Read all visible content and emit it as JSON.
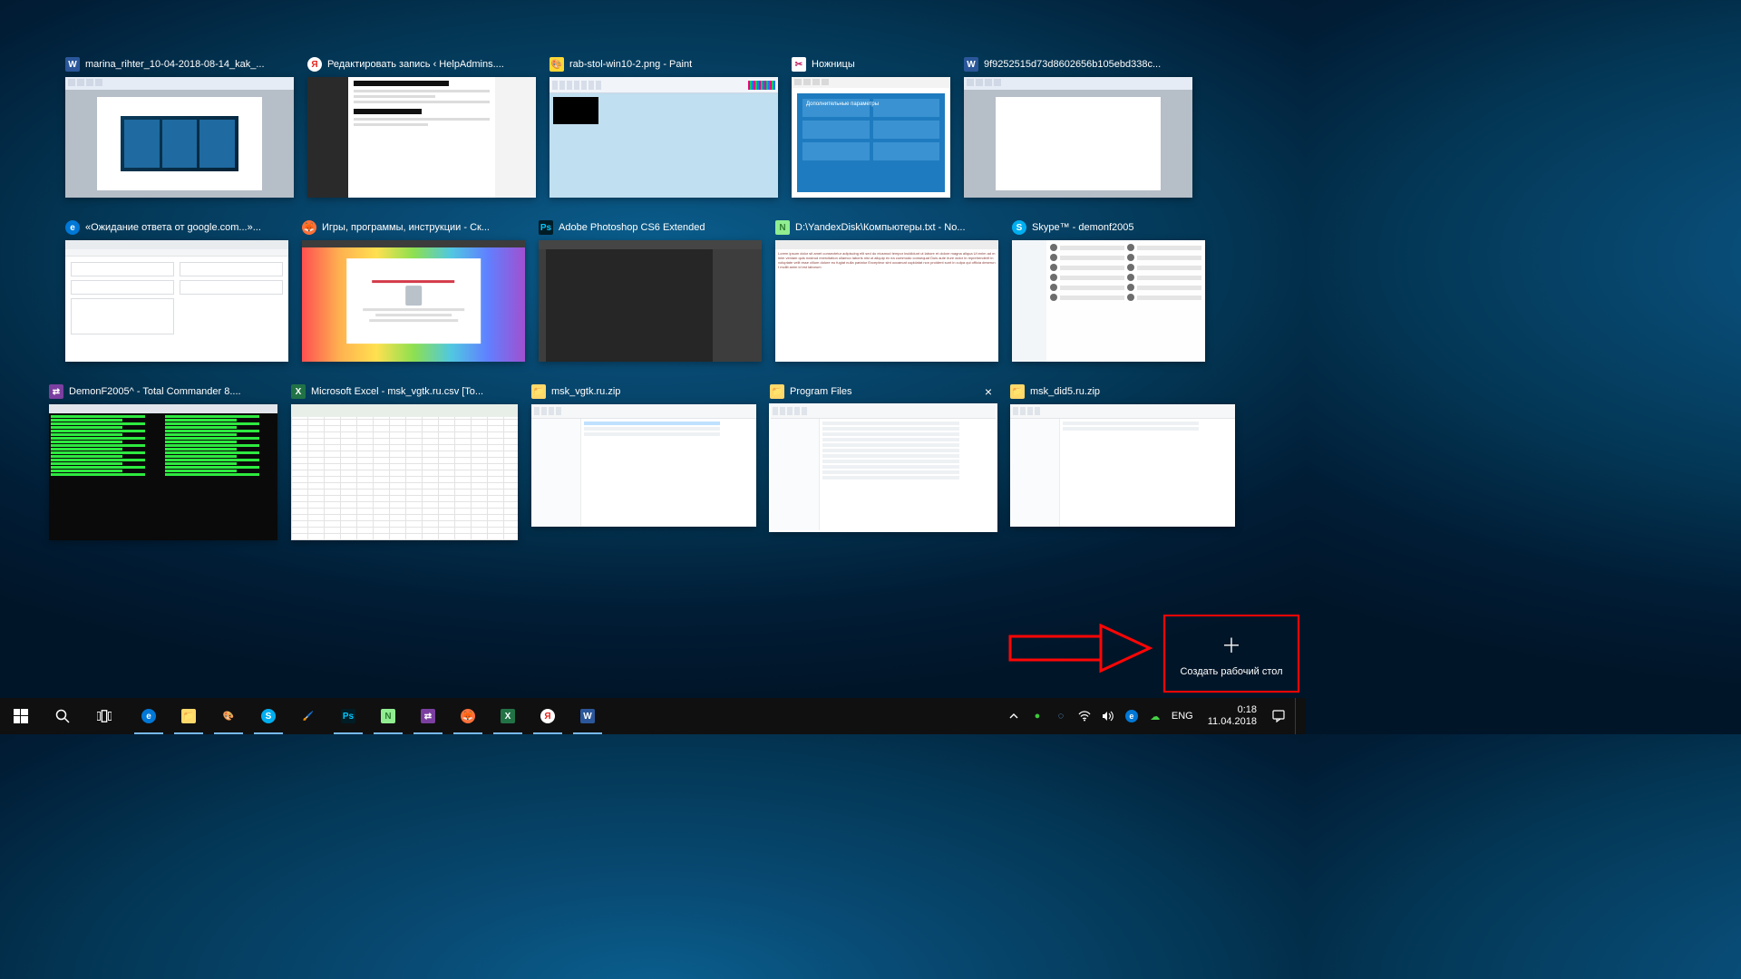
{
  "rows": [
    [
      {
        "id": "word1",
        "icon": "word",
        "title": "marina_rihter_10-04-2018-08-14_kak_..."
      },
      {
        "id": "yandex",
        "icon": "yandex",
        "title": "Редактировать запись ‹ HelpAdmins...."
      },
      {
        "id": "paint",
        "icon": "paint",
        "title": "rab-stol-win10-2.png - Paint"
      },
      {
        "id": "snip",
        "icon": "snip",
        "title": "Ножницы",
        "snip_caption": "Дополнительные параметры"
      },
      {
        "id": "word2",
        "icon": "word",
        "title": "9f9252515d73d8602656b105ebd338c..."
      }
    ],
    [
      {
        "id": "edge",
        "icon": "edge",
        "title": "«Ожидание ответа от google.com...»..."
      },
      {
        "id": "firefox",
        "icon": "firefox",
        "title": "Игры, программы, инструкции - Ск..."
      },
      {
        "id": "ps",
        "icon": "ps",
        "title": "Adobe Photoshop CS6 Extended"
      },
      {
        "id": "npp",
        "icon": "npp",
        "title": "D:\\YandexDisk\\Компьютеры.txt - No..."
      },
      {
        "id": "skype",
        "icon": "skype",
        "title": "Skype™ - demonf2005"
      }
    ],
    [
      {
        "id": "tc",
        "icon": "tc",
        "title": "DemonF2005^ - Total Commander 8...."
      },
      {
        "id": "excel",
        "icon": "excel",
        "title": "Microsoft Excel - msk_vgtk.ru.csv  [To..."
      },
      {
        "id": "zip1",
        "icon": "folder",
        "title": "msk_vgtk.ru.zip"
      },
      {
        "id": "pf",
        "icon": "folder",
        "title": "Program Files",
        "selected": true,
        "show_close": true
      },
      {
        "id": "zip2",
        "icon": "folder",
        "title": "msk_did5.ru.zip"
      }
    ]
  ],
  "new_desktop_label": "Создать рабочий стол",
  "close_glyph": "×",
  "taskbar_apps": [
    {
      "name": "edge",
      "running": true
    },
    {
      "name": "explorer",
      "running": true
    },
    {
      "name": "paint",
      "running": true
    },
    {
      "name": "skype",
      "running": true
    },
    {
      "name": "paintapp",
      "running": false
    },
    {
      "name": "photoshop",
      "running": true
    },
    {
      "name": "notepadpp",
      "running": true
    },
    {
      "name": "totalcmd",
      "running": true
    },
    {
      "name": "firefox",
      "running": true
    },
    {
      "name": "excel",
      "running": true
    },
    {
      "name": "yandex",
      "running": true
    },
    {
      "name": "word",
      "running": true
    }
  ],
  "tray": {
    "lang": "ENG",
    "time": "0:18",
    "date": "11.04.2018"
  }
}
